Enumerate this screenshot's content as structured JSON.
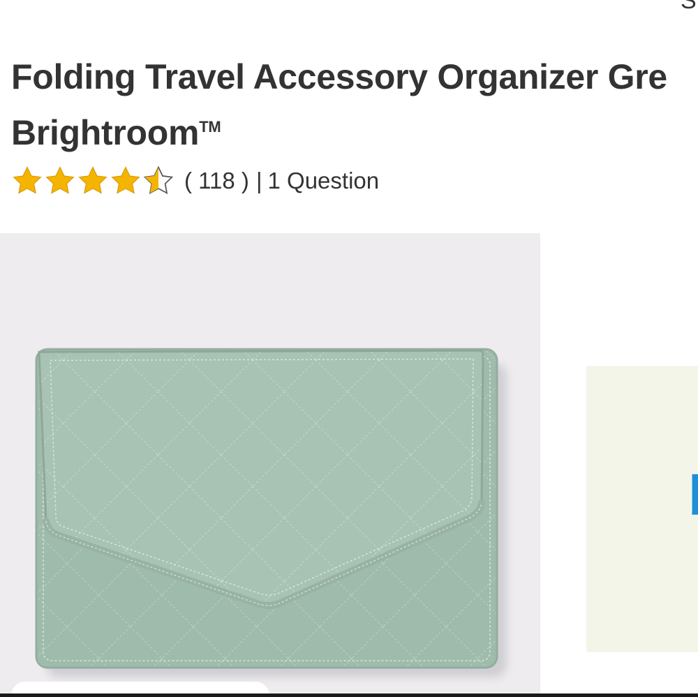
{
  "header": {
    "cut_text": "S"
  },
  "product": {
    "title_line1": "Folding Travel Accessory Organizer Gre",
    "title_line2": "Brightroom",
    "trademark": "TM",
    "rating": {
      "value": 4.5,
      "max": 5,
      "count_text": "( 118 )",
      "separator": "|",
      "questions_text": "1 Question",
      "star_color": "#f5b400"
    }
  },
  "gallery": {
    "main_image": "green-quilted-travel-organizer-image",
    "next_image_glyph": "b",
    "next_image_accent": "#1e8fd8"
  }
}
